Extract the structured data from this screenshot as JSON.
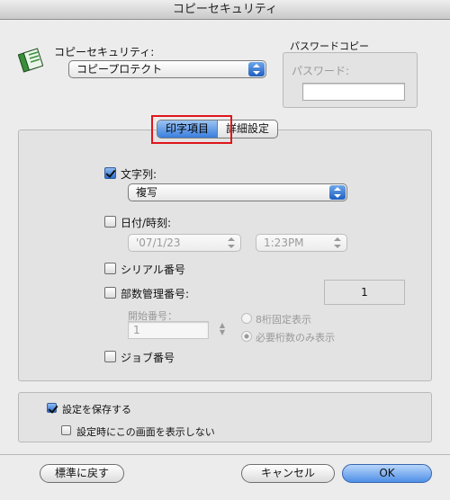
{
  "window": {
    "title": "コピーセキュリティ"
  },
  "copy_security": {
    "label": "コピーセキュリティ:",
    "selected": "コピープロテクト"
  },
  "password_copy": {
    "group_title": "パスワードコピー",
    "password_label": "パスワード:",
    "password_value": ""
  },
  "tabs": [
    {
      "label": "印字項目",
      "active": true
    },
    {
      "label": "詳細設定",
      "active": false
    }
  ],
  "print_items": {
    "text": {
      "label": "文字列:",
      "checked": true,
      "value": "複写"
    },
    "datetime": {
      "label": "日付/時刻:",
      "checked": false,
      "date": "'07/1/23",
      "time": "1:23PM"
    },
    "serial": {
      "label": "シリアル番号",
      "checked": false
    },
    "copy_count": {
      "label": "部数管理番号:",
      "checked": false,
      "value": "1",
      "start_label": "開始番号：",
      "start_value": "1",
      "option_fixed": "8桁固定表示",
      "option_required": "必要桁数のみ表示"
    },
    "job_number": {
      "label": "ジョブ番号",
      "checked": false
    }
  },
  "save_settings": {
    "label": "設定を保存する",
    "checked": true,
    "dont_show_label": "設定時にこの画面を表示しない",
    "dont_show_checked": false
  },
  "buttons": {
    "defaults": "標準に戻す",
    "cancel": "キャンセル",
    "ok": "OK"
  },
  "colors": {
    "accent": "#3a7fde",
    "highlight_box": "#e0151b"
  }
}
